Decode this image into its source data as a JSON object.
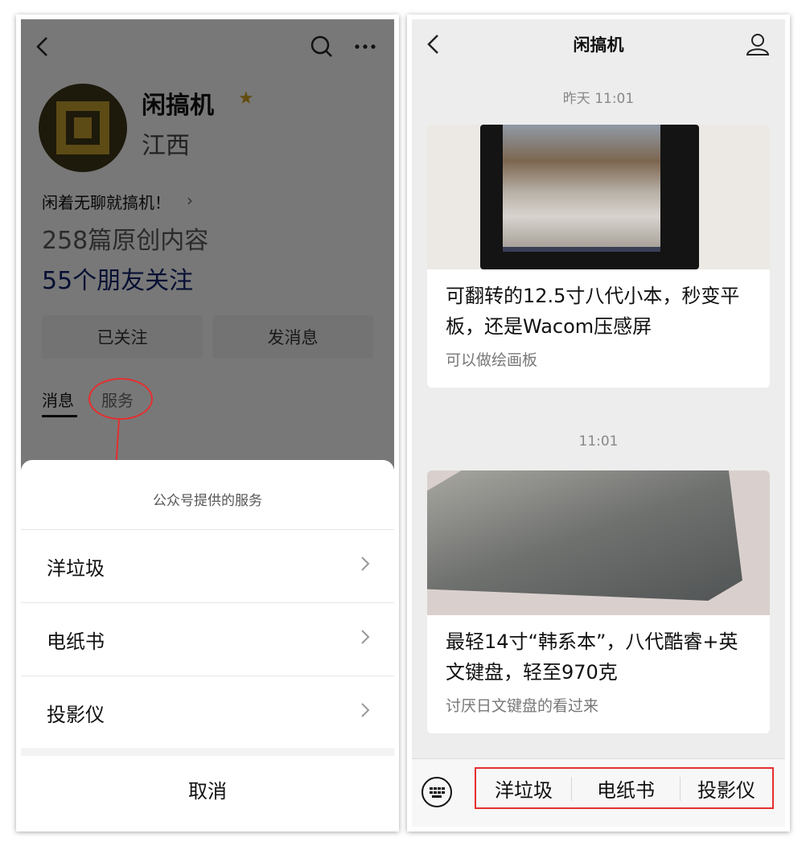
{
  "left": {
    "profile": {
      "name": "闲搞机",
      "region": "江西",
      "slogan": "闲着无聊就搞机！",
      "articles": "258篇原创内容",
      "friends": "55个朋友关注"
    },
    "buttons": {
      "following": "已关注",
      "message": "发消息"
    },
    "tabs": {
      "messages": "消息",
      "services": "服务"
    },
    "sheet": {
      "title": "公众号提供的服务",
      "items": [
        "洋垃圾",
        "电纸书",
        "投影仪"
      ],
      "cancel": "取消"
    }
  },
  "right": {
    "header": {
      "title": "闲搞机"
    },
    "messages": [
      {
        "time": "昨天 11:01",
        "title": "可翻转的12.5寸八代小本，秒变平板，还是Wacom压感屏",
        "subtitle": "可以做绘画板"
      },
      {
        "time": "11:01",
        "title": "最轻14寸“韩系本”，八代酷睿+英文键盘，轻至970克",
        "subtitle": "讨厌日文键盘的看过来"
      }
    ],
    "menu": [
      "洋垃圾",
      "电纸书",
      "投影仪"
    ]
  },
  "colors": {
    "annotation_red": "#e52f2f",
    "friends_blue": "#0d1f66",
    "star_gold": "#c79a1c"
  },
  "icons": [
    "back-arrow-icon",
    "search-icon",
    "more-icon",
    "star-icon",
    "chevron-right-icon",
    "user-icon",
    "keyboard-icon"
  ]
}
